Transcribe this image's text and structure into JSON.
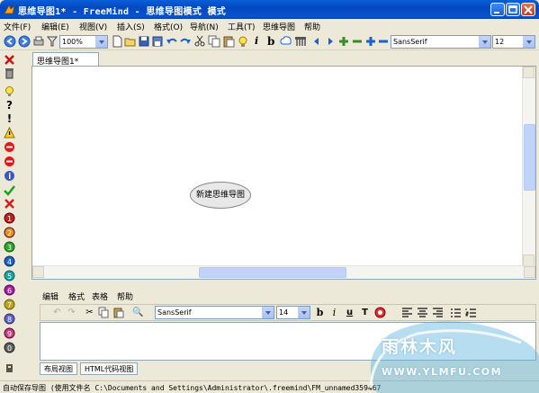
{
  "window": {
    "title": "思维导图1* - FreeMind - 思维导图模式 模式",
    "buttons": [
      "minimize",
      "maximize",
      "close"
    ]
  },
  "menubar": {
    "items": [
      "文件(F)",
      "编辑(E)",
      "视图(V)",
      "插入(S)",
      "格式(O)",
      "导航(N)",
      "工具(T)",
      "思维导图",
      "帮助"
    ]
  },
  "toolbar": {
    "zoom_value": "100%",
    "font_family": "SansSerif",
    "font_size": "12",
    "icons": [
      "back-icon",
      "forward-icon",
      "print-icon",
      "filter-icon",
      "new-icon",
      "open-icon",
      "save-icon",
      "save-as-icon",
      "undo-icon",
      "redo-icon",
      "cut-icon",
      "copy-icon",
      "paste-icon",
      "bulb-icon",
      "italic-icon",
      "bold-icon",
      "cloud-icon",
      "edge-icon",
      "left-icon",
      "right-icon",
      "plus-icon",
      "minus-icon"
    ]
  },
  "iconbar": {
    "icons": [
      "remove-last-icon",
      "remove-all-icon",
      "idea-icon",
      "question-icon",
      "important-icon",
      "warning-icon",
      "stop-icon",
      "no-entry-icon",
      "info-icon",
      "ok-icon",
      "not-ok-icon",
      "priority-1-icon",
      "priority-2-icon",
      "priority-3-icon",
      "priority-4-icon",
      "priority-5-icon",
      "priority-6-icon",
      "priority-7-icon",
      "priority-8-icon",
      "priority-9-icon",
      "priority-0-icon",
      "more-icon"
    ]
  },
  "map": {
    "tab_label": "思维导图1*",
    "root_node": "新建思维导图"
  },
  "editor": {
    "menu": [
      "编辑",
      "格式",
      "表格",
      "帮助"
    ],
    "font_family": "SansSerif",
    "font_size": "14",
    "tabs": [
      "布局视图",
      "HTML代码视图"
    ]
  },
  "statusbar": {
    "text": "自动保存导图 (使用文件名 C:\\Documents and Settings\\Administrator\\.freemind\\FM_unnamed359467"
  },
  "watermark": {
    "logo": "雨林木风",
    "url": "WWW.YLMFU.COM"
  },
  "colors": {
    "titlebar": "#0a52cc",
    "window_bg": "#ece9d8",
    "node_fill": "#e8e8e8",
    "scroll_thumb": "#c1d3fb"
  }
}
